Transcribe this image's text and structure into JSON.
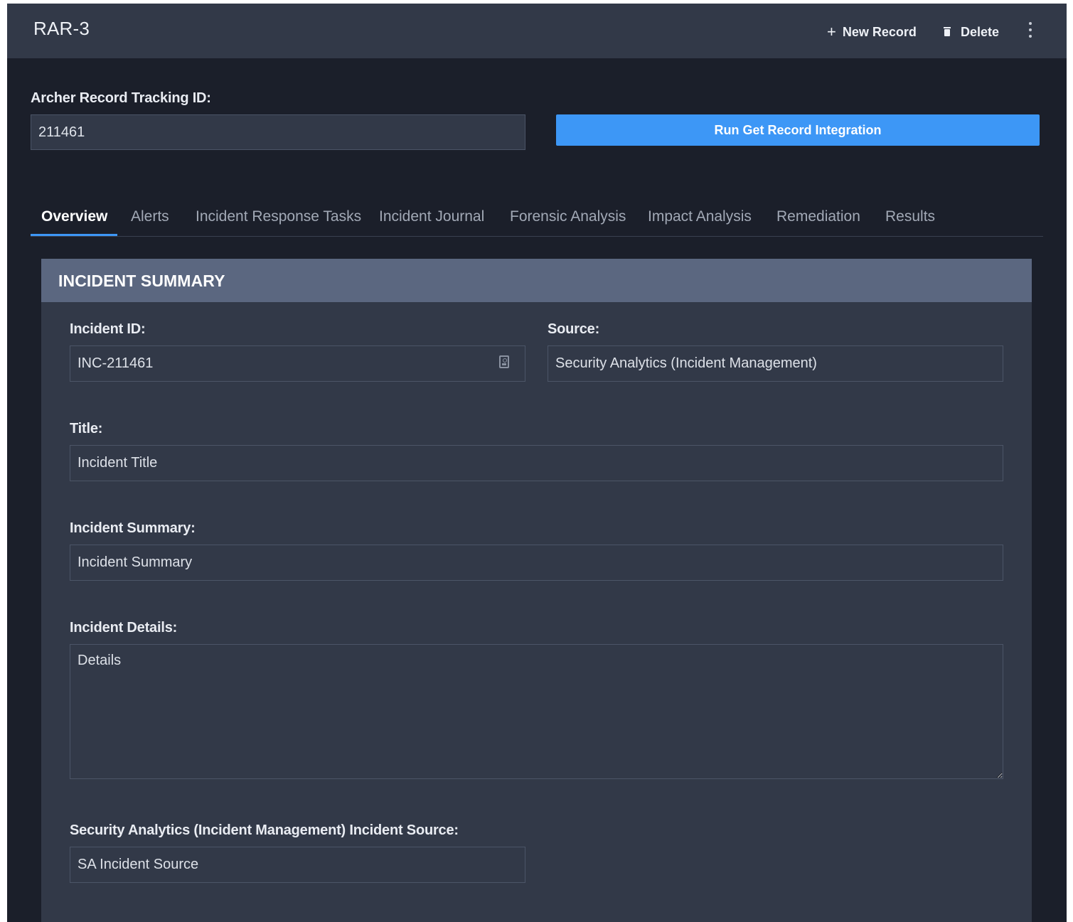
{
  "header": {
    "record_title": "RAR-3",
    "new_record_label": "New Record",
    "delete_label": "Delete"
  },
  "tracking": {
    "label": "Archer Record Tracking ID:",
    "value": "211461",
    "run_button_label": "Run Get Record Integration"
  },
  "tabs": [
    {
      "label": "Overview",
      "active": true
    },
    {
      "label": "Alerts",
      "active": false
    },
    {
      "label": "Incident Response Tasks",
      "active": false
    },
    {
      "label": "Incident Journal",
      "active": false
    },
    {
      "label": "Forensic Analysis",
      "active": false
    },
    {
      "label": "Impact Analysis",
      "active": false
    },
    {
      "label": "Remediation",
      "active": false
    },
    {
      "label": "Results",
      "active": false
    }
  ],
  "panel": {
    "title": "INCIDENT SUMMARY",
    "fields": {
      "incident_id": {
        "label": "Incident ID:",
        "value": "INC-211461"
      },
      "source": {
        "label": "Source:",
        "value": "Security Analytics (Incident Management)"
      },
      "title": {
        "label": "Title:",
        "value": "Incident Title"
      },
      "summary": {
        "label": "Incident Summary:",
        "value": "Incident Summary"
      },
      "details": {
        "label": "Incident Details:",
        "value": "Details"
      },
      "sa_source": {
        "label": "Security Analytics (Incident Management) Incident Source:",
        "value": "SA Incident Source"
      }
    }
  },
  "colors": {
    "accent": "#3d97f6",
    "background": "#1b1f2a",
    "surface": "#323948",
    "panel_header": "#5b6780"
  },
  "icons": {
    "new_record": "plus-icon",
    "delete": "trash-icon",
    "more": "kebab-menu-icon",
    "incident_id": "contact-card-icon"
  }
}
